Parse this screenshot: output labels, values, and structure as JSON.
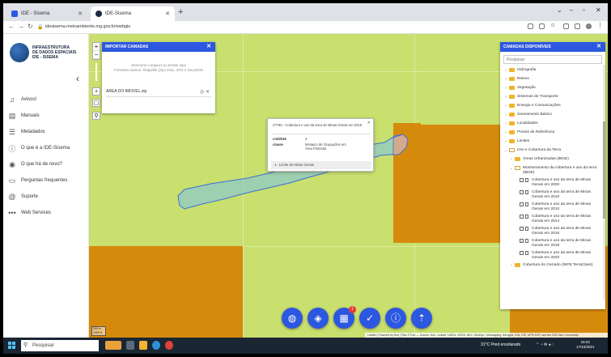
{
  "browser": {
    "tabs": [
      {
        "label": "IDE - Sisema"
      },
      {
        "label": "IDE-Sisema"
      }
    ],
    "url": "idesisema.meioambiente.mg.gov.br/webgis"
  },
  "sidebar": {
    "logo_lines": [
      "INFRAESTRUTURA",
      "DE DADOS ESPACIAIS",
      "IDE - SISEMA"
    ],
    "items": [
      {
        "label": "Avisos!",
        "icon": "bell-icon"
      },
      {
        "label": "Manuais",
        "icon": "book-icon"
      },
      {
        "label": "Metadados",
        "icon": "document-icon"
      },
      {
        "label": "O que é a IDE-Sisema",
        "icon": "info-icon"
      },
      {
        "label": "O que há de novo?",
        "icon": "broadcast-icon"
      },
      {
        "label": "Perguntas frequentes",
        "icon": "chat-icon"
      },
      {
        "label": "Suporte",
        "icon": "at-icon"
      },
      {
        "label": "Web Services",
        "icon": "dots-icon"
      }
    ]
  },
  "import_panel": {
    "title": "IMPORTAR CAMADAS",
    "hint_line1": "Selecione o arquivo ou arraste aqui",
    "hint_line2": "Formatos aceitos: Shapefile (zip), KML, GPX e GeoJSON",
    "file_name": "AREA DO IMOVEL.zip"
  },
  "popup": {
    "title": "27766 - Cobertura e uso da terra de Minas Gerais em 2016",
    "rows": [
      {
        "key": "cod2016",
        "value": "4"
      },
      {
        "key": "classe",
        "value": "Mosaico de Ocupações em Área Florestal"
      }
    ],
    "footer": "1 - Limite de Minas Gerais"
  },
  "layers_panel": {
    "title": "CAMADAS DISPONÍVEIS",
    "search_placeholder": "Pesquisar",
    "items": [
      {
        "label": "Hidrografia",
        "level": 0,
        "kind": "folder"
      },
      {
        "label": "Relevo",
        "level": 0,
        "kind": "folder"
      },
      {
        "label": "Vegetação",
        "level": 0,
        "kind": "folder"
      },
      {
        "label": "Sistemas de Transporte",
        "level": 0,
        "kind": "folder"
      },
      {
        "label": "Energia e Comunicações",
        "level": 0,
        "kind": "folder"
      },
      {
        "label": "Saneamento Básico",
        "level": 0,
        "kind": "folder"
      },
      {
        "label": "Localidades",
        "level": 0,
        "kind": "folder"
      },
      {
        "label": "Pontos de Referência",
        "level": 0,
        "kind": "folder"
      },
      {
        "label": "Limites",
        "level": 0,
        "kind": "folder"
      },
      {
        "label": "Uso e Cobertura da Terra",
        "level": 0,
        "kind": "folder-open"
      },
      {
        "label": "Áreas Urbanizadas (IBGE)",
        "level": 1,
        "kind": "folder"
      },
      {
        "label": "Monitoramento da cobertura e uso da terra (IBGE)",
        "level": 1,
        "kind": "folder-open"
      },
      {
        "label": "Cobertura e uso da terra de Minas Gerais em 2000",
        "level": 2,
        "kind": "layer",
        "checked": false
      },
      {
        "label": "Cobertura e uso da terra de Minas Gerais em 2010",
        "level": 2,
        "kind": "layer",
        "checked": false
      },
      {
        "label": "Cobertura e uso da terra de Minas Gerais em 2012",
        "level": 2,
        "kind": "layer",
        "checked": false
      },
      {
        "label": "Cobertura e uso da terra de Minas Gerais em 2014",
        "level": 2,
        "kind": "layer",
        "checked": false
      },
      {
        "label": "Cobertura e uso da terra de Minas Gerais em 2016",
        "level": 2,
        "kind": "layer",
        "checked": false
      },
      {
        "label": "Cobertura e uso da terra de Minas Gerais em 2018",
        "level": 2,
        "kind": "layer",
        "checked": true
      },
      {
        "label": "Cobertura e uso da terra de Minas Gerais em 2020",
        "level": 2,
        "kind": "layer",
        "checked": false
      },
      {
        "label": "Cobertura do Cerrado (INPE TerraClass)",
        "level": 1,
        "kind": "folder"
      }
    ]
  },
  "map": {
    "attribution": "Leaflet | Powered by Esri | Tiles © Esri — Source: Esri, i-cubed, USDA, USGS, AEX, GeoEye, Getmapping, Aerogrid, IGN, IGP, UPR-EGP, and the GIS User Community",
    "scale_top": "500 m",
    "scale_bottom": "1000 ft",
    "fab_badge": "1"
  },
  "taskbar": {
    "search_placeholder": "Pesquisar",
    "weather": "31°C  Pred ensolarado",
    "time": "16:02",
    "date": "17/10/2021"
  }
}
